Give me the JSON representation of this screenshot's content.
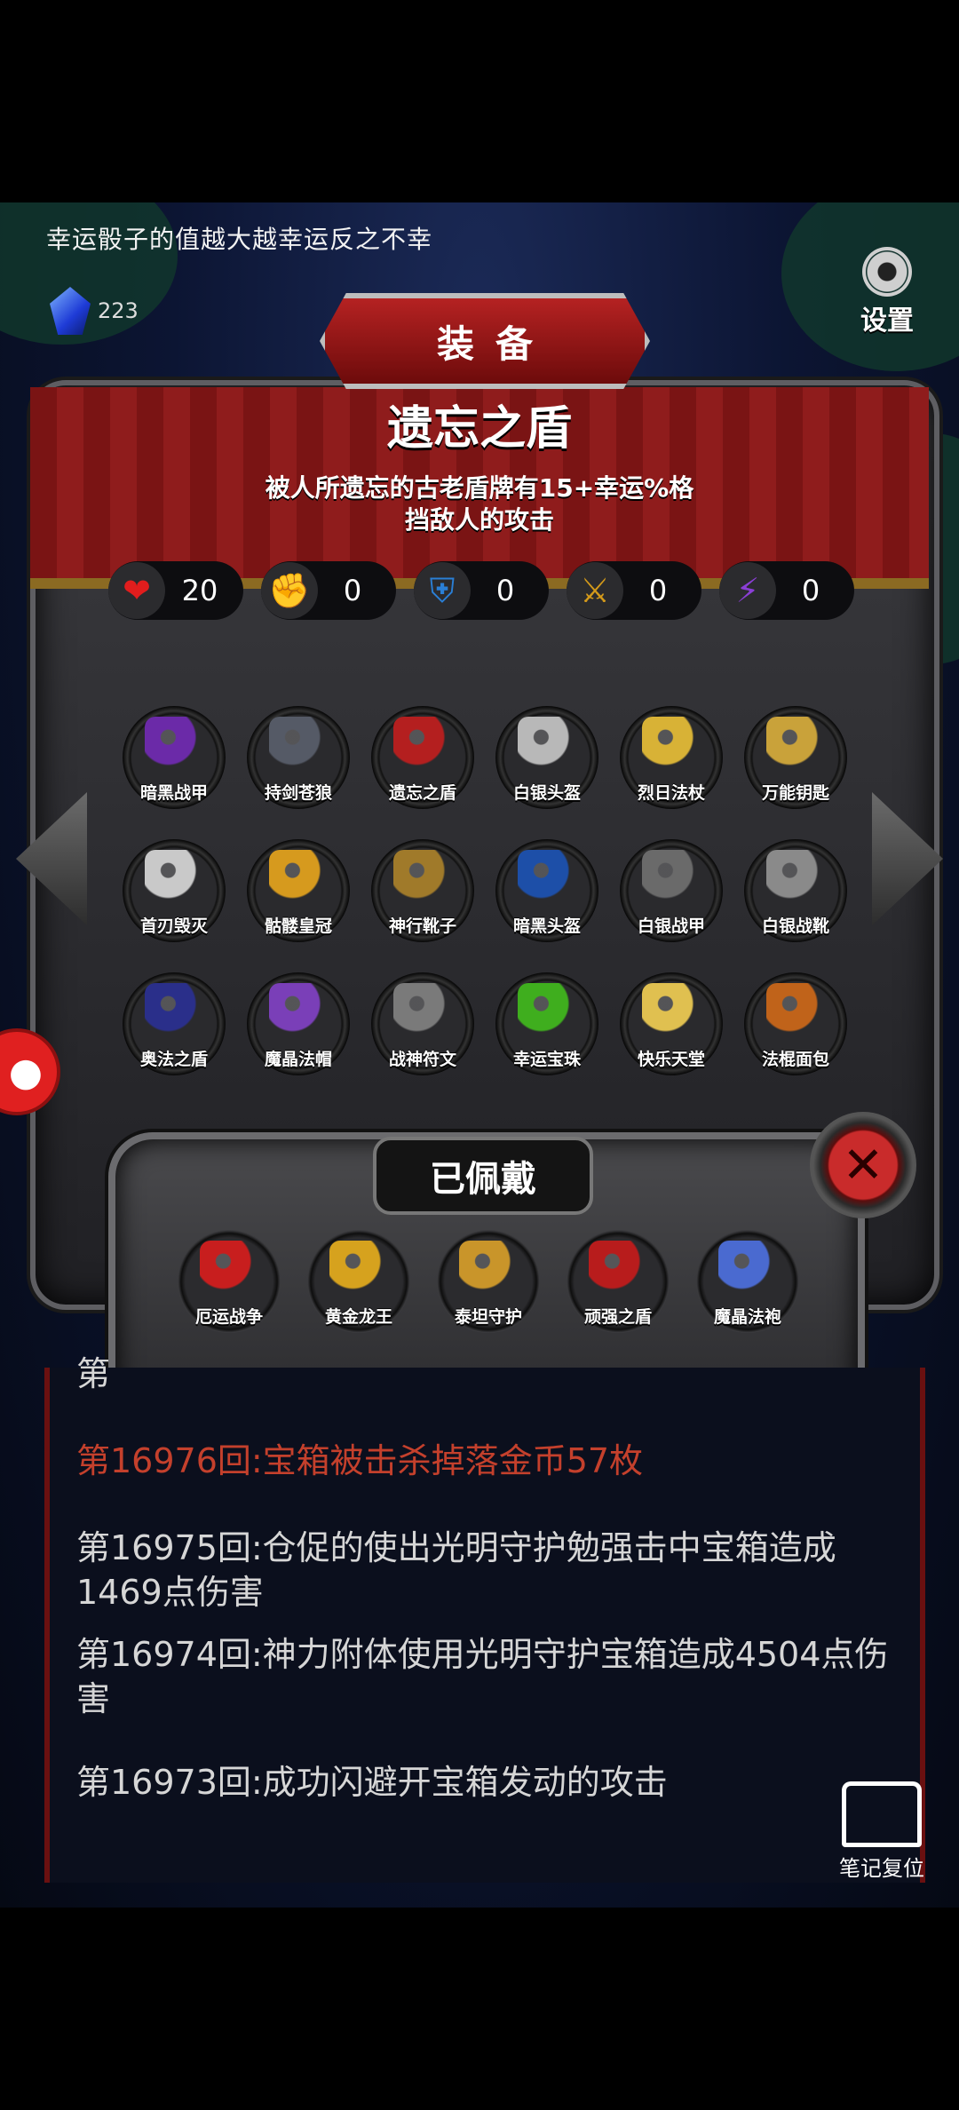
{
  "top_tip": "幸运骰子的值越大越幸运反之不幸",
  "gem_count": "223",
  "settings_label": "设置",
  "panel_title": "装备",
  "item": {
    "name": "遗忘之盾",
    "description": "被人所遗忘的古老盾牌有15+幸运%格\n挡敌人的攻击"
  },
  "stats": [
    {
      "icon": "heart-icon",
      "value": "20",
      "color": "#e11d1d",
      "glyph": "❤"
    },
    {
      "icon": "strength-icon",
      "value": "0",
      "color": "#d4b01a",
      "glyph": "✊"
    },
    {
      "icon": "armor-icon",
      "value": "0",
      "color": "#2a7fd6",
      "glyph": "⛨"
    },
    {
      "icon": "sword-icon",
      "value": "0",
      "color": "#d49a1a",
      "glyph": "⚔"
    },
    {
      "icon": "lightning-icon",
      "value": "0",
      "color": "#8b3fd6",
      "glyph": "⚡"
    }
  ],
  "inventory": [
    {
      "label": "暗黑战甲",
      "color": "#6b2aa8"
    },
    {
      "label": "持剑苍狼",
      "color": "#555a66"
    },
    {
      "label": "遗忘之盾",
      "color": "#b41f1f"
    },
    {
      "label": "白银头盔",
      "color": "#b8b8b8"
    },
    {
      "label": "烈日法杖",
      "color": "#d8b236"
    },
    {
      "label": "万能钥匙",
      "color": "#c9a23a"
    },
    {
      "label": "首刃毁灭",
      "color": "#c9c9c9"
    },
    {
      "label": "骷髅皇冠",
      "color": "#d69a1e"
    },
    {
      "label": "神行靴子",
      "color": "#a07a2a"
    },
    {
      "label": "暗黑头盔",
      "color": "#1d4fa8"
    },
    {
      "label": "白银战甲",
      "color": "#6a6a6a"
    },
    {
      "label": "白银战靴",
      "color": "#8a8a8a"
    },
    {
      "label": "奥法之盾",
      "color": "#2a2f8a"
    },
    {
      "label": "魔晶法帽",
      "color": "#7a3fb8"
    },
    {
      "label": "战神符文",
      "color": "#7a7a7a"
    },
    {
      "label": "幸运宝珠",
      "color": "#3fae1e"
    },
    {
      "label": "快乐天堂",
      "color": "#e0c050"
    },
    {
      "label": "法棍面包",
      "color": "#c0631a"
    }
  ],
  "equipped_title": "已佩戴",
  "equipped": [
    {
      "label": "厄运战争",
      "color": "#c81e1e"
    },
    {
      "label": "黄金龙王",
      "color": "#d6a21e"
    },
    {
      "label": "泰坦守护",
      "color": "#c9952a"
    },
    {
      "label": "顽强之盾",
      "color": "#b81c1c"
    },
    {
      "label": "魔晶法袍",
      "color": "#4a6ad0"
    }
  ],
  "log_partial": "第",
  "log": [
    {
      "text": "第16976回:宝箱被击杀掉落金币57枚",
      "highlight": true
    },
    {
      "text": "第16975回:仓促的使出光明守护勉强击中宝箱造成1469点伤害",
      "highlight": false
    },
    {
      "text": "第16974回:神力附体使用光明守护宝箱造成4504点伤害",
      "highlight": false
    },
    {
      "text": "第16973回:成功闪避开宝箱发动的攻击",
      "highlight": false
    }
  ],
  "note_reset_label": "笔记复位"
}
